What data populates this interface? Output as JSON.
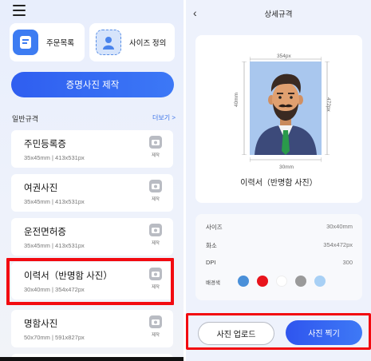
{
  "left": {
    "quick_actions": [
      {
        "label": "주문목록",
        "icon": "order-list-icon"
      },
      {
        "label": "사이즈 정의",
        "icon": "size-define-icon"
      }
    ],
    "primary_button": "증명사진 제작",
    "section_title": "일반규격",
    "more_link": "더보기 >",
    "cards": [
      {
        "name": "주민등록증",
        "spec": "35x45mm | 413x531px",
        "action": "제작"
      },
      {
        "name": "여권사진",
        "spec": "35x45mm | 413x531px",
        "action": "제작"
      },
      {
        "name": "운전면허증",
        "spec": "35x45mm | 413x531px",
        "action": "제작"
      },
      {
        "name": "이력서（반명함 사진）",
        "spec": "30x40mm | 354x472px",
        "action": "제작"
      },
      {
        "name": "명함사진",
        "spec": "50x70mm | 591x827px",
        "action": "제작"
      }
    ]
  },
  "right": {
    "title": "상세규격",
    "preview": {
      "width_px": "354px",
      "width_mm": "30mm",
      "height_mm": "40mm",
      "height_px": "472px",
      "caption": "이력서（반명함 사진）"
    },
    "specs": [
      {
        "key": "사이즈",
        "value": "30x40mm"
      },
      {
        "key": "화소",
        "value": "354x472px"
      },
      {
        "key": "DPI",
        "value": "300"
      }
    ],
    "bg_label": "배경색",
    "bg_colors": [
      "#4a90d9",
      "#e8141c",
      "#ffffff",
      "#9a9a9a",
      "#a8d0f5"
    ],
    "upload_button": "사진 업로드",
    "shoot_button": "사진 찍기"
  }
}
